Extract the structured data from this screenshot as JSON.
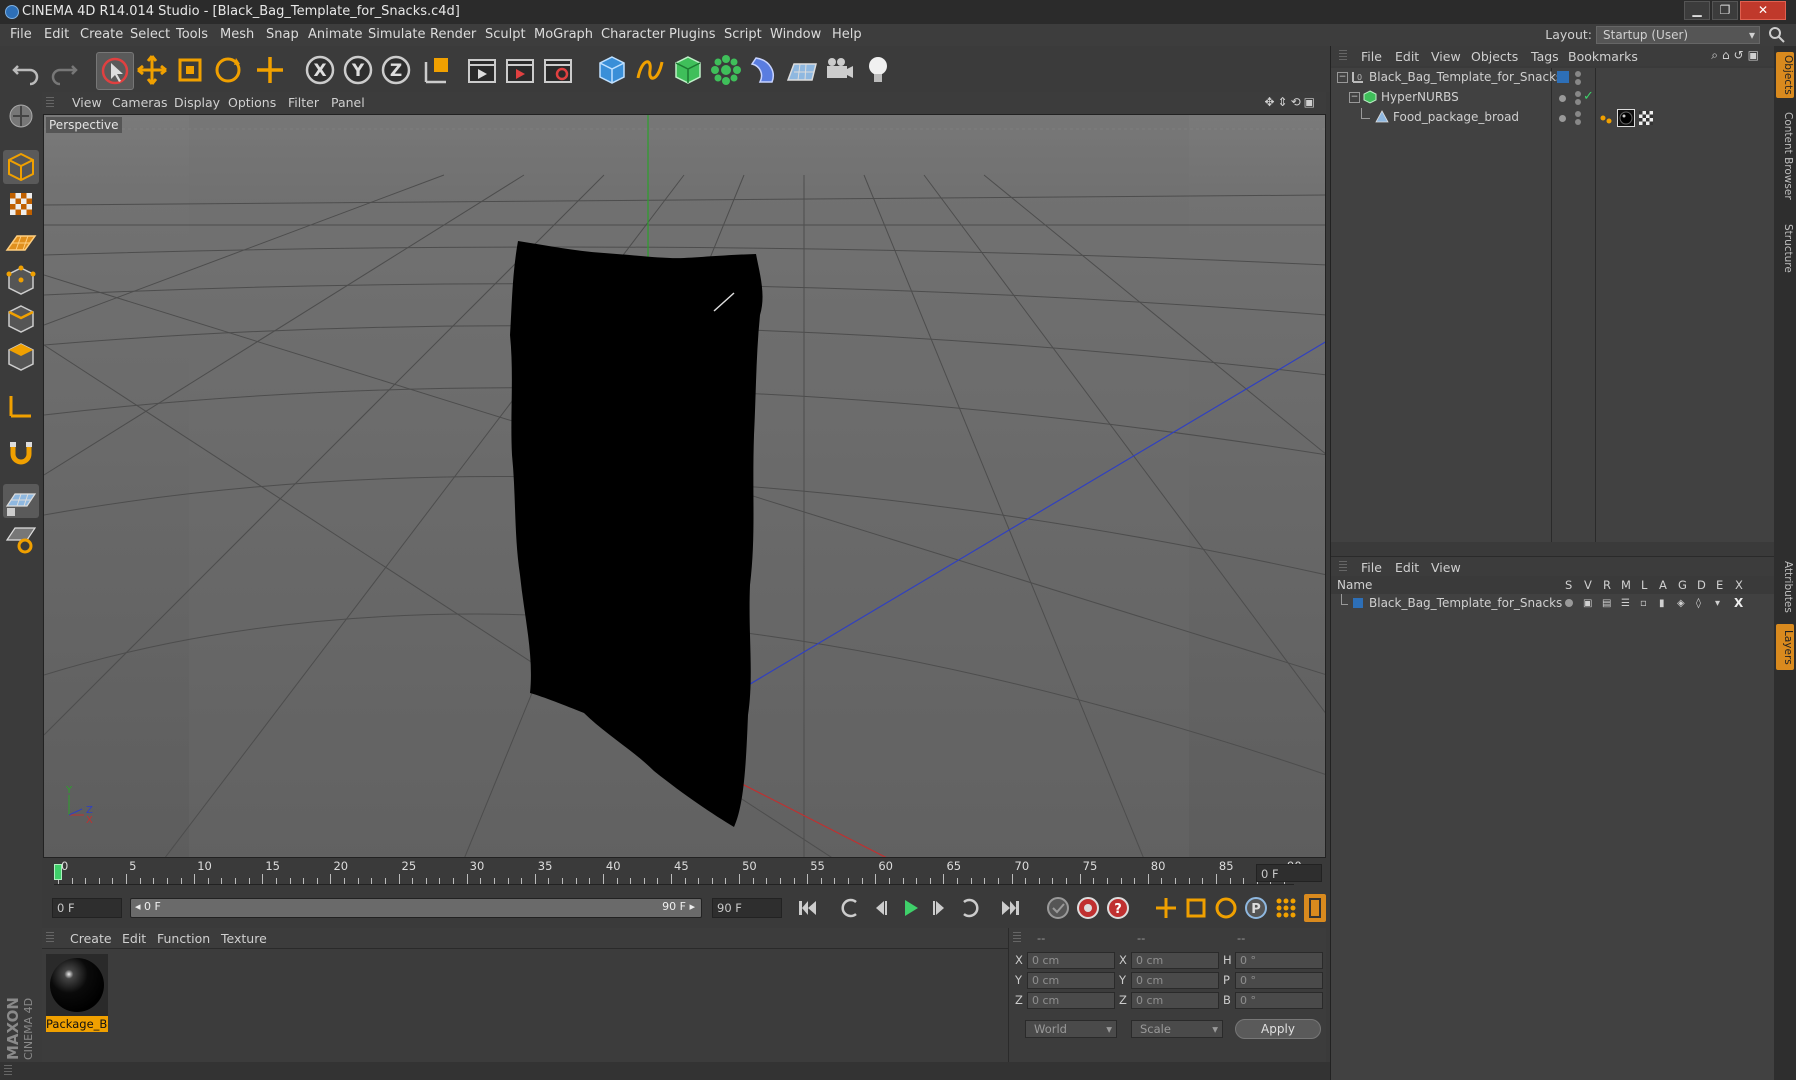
{
  "titlebar": {
    "title": "CINEMA 4D R14.014 Studio - [Black_Bag_Template_for_Snacks.c4d]",
    "controls": {
      "minimize": "▁",
      "restore": "❐",
      "close": "✕"
    }
  },
  "menu": {
    "items": [
      "File",
      "Edit",
      "Create",
      "Select",
      "Tools",
      "Mesh",
      "Snap",
      "Animate",
      "Simulate",
      "Render",
      "Sculpt",
      "MoGraph",
      "Character",
      "Plugins",
      "Script",
      "Window",
      "Help"
    ],
    "layout_label": "Layout:",
    "layout_value": "Startup (User)"
  },
  "toolbar": {
    "icons": [
      "undo-icon",
      "redo-icon",
      "live-selection-icon",
      "move-icon",
      "scale-icon",
      "rotate-icon",
      "add-object-icon",
      "x-axis-icon",
      "y-axis-icon",
      "z-axis-icon",
      "coordinate-system-icon",
      "render-view-icon",
      "render-picture-viewer-icon",
      "edit-render-settings-icon",
      "cube-icon",
      "spline-icon",
      "nurbs-icon",
      "array-icon",
      "deformer-icon",
      "scene-floor-icon",
      "camera-icon",
      "light-icon"
    ],
    "axis_letters": [
      "X",
      "Y",
      "Z"
    ]
  },
  "left_tools": [
    "make-editable-icon",
    "model-mode-icon",
    "texture-mode-icon",
    "workplane-icon",
    "points-mode-icon",
    "edges-mode-icon",
    "polygons-mode-icon",
    "axis-mode-icon",
    "snap-icon",
    "lock-workplane-icon",
    "planar-workplane-icon"
  ],
  "viewport": {
    "menu": [
      "View",
      "Cameras",
      "Display",
      "Options",
      "Filter",
      "Panel"
    ],
    "label": "Perspective",
    "axis_labels": {
      "y": "Y",
      "x": "X",
      "z": "Z"
    }
  },
  "timeline": {
    "ticks": [
      "0",
      "5",
      "10",
      "15",
      "20",
      "25",
      "30",
      "35",
      "40",
      "45",
      "50",
      "55",
      "60",
      "65",
      "70",
      "75",
      "80",
      "85",
      "90"
    ],
    "frame_end_display": "0 F",
    "current_frame": "0 F",
    "range_start": "◂ 0 F",
    "range_end": "90 F ▸",
    "max_frame": "90 F"
  },
  "material_manager": {
    "menu": [
      "Create",
      "Edit",
      "Function",
      "Texture"
    ],
    "material_name": "Package_Bl"
  },
  "coordinates": {
    "headers": [
      "--",
      "--",
      "--"
    ],
    "rows": [
      {
        "a": "X",
        "a_val": "0 cm",
        "b": "X",
        "b_val": "0 cm",
        "c": "H",
        "c_val": "0 °"
      },
      {
        "a": "Y",
        "a_val": "0 cm",
        "b": "Y",
        "b_val": "0 cm",
        "c": "P",
        "c_val": "0 °"
      },
      {
        "a": "Z",
        "a_val": "0 cm",
        "b": "Z",
        "b_val": "0 cm",
        "c": "B",
        "c_val": "0 °"
      }
    ],
    "space": "World",
    "mode": "Scale",
    "apply": "Apply"
  },
  "object_manager": {
    "menu": [
      "File",
      "Edit",
      "View",
      "Objects",
      "Tags",
      "Bookmarks"
    ],
    "objects": [
      {
        "name": "Black_Bag_Template_for_Snacks",
        "depth": 0
      },
      {
        "name": "HyperNURBS",
        "depth": 1
      },
      {
        "name": "Food_package_broad",
        "depth": 2
      }
    ]
  },
  "layer_manager": {
    "menu": [
      "File",
      "Edit",
      "View"
    ],
    "columns": [
      "Name",
      "S",
      "V",
      "R",
      "M",
      "L",
      "A",
      "G",
      "D",
      "E",
      "X"
    ],
    "layers": [
      {
        "name": "Black_Bag_Template_for_Snacks"
      }
    ]
  },
  "side_tabs": [
    "Objects",
    "Content Browser",
    "Structure",
    "Attributes",
    "Layers"
  ],
  "brand": {
    "line1": "MAXON",
    "line2": "CINEMA 4D"
  },
  "colors": {
    "accent": "#f0a000",
    "active_tab": "#d98a1e",
    "x_axis": "#c03030",
    "y_axis": "#2ca02c",
    "z_axis": "#3040c0"
  }
}
